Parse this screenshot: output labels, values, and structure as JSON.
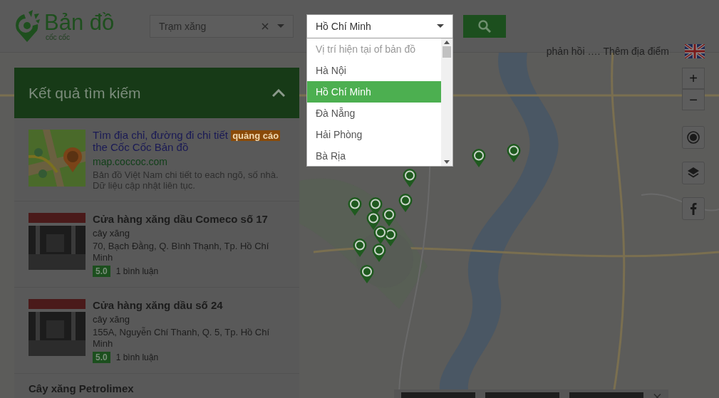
{
  "header": {
    "logo": {
      "title": "Bản đồ",
      "subtitle": "cốc cốc"
    },
    "search_field": {
      "value": "Trạm xăng"
    },
    "city_select": {
      "value": "Hồ Chí Minh",
      "expanded": true,
      "options": [
        {
          "label": "Vị trí hiện tại of bản đồ",
          "selected": false,
          "disabled": true
        },
        {
          "label": "Hà Nội",
          "selected": false,
          "disabled": false
        },
        {
          "label": "Hồ Chí Minh",
          "selected": true,
          "disabled": false
        },
        {
          "label": "Đà Nẵng",
          "selected": false,
          "disabled": false
        },
        {
          "label": "Hải Phòng",
          "selected": false,
          "disabled": false
        },
        {
          "label": "Bà Rịa",
          "selected": false,
          "disabled": false
        }
      ]
    }
  },
  "top_links": {
    "links": [
      "phản hồi",
      "Thêm địa điểm"
    ],
    "separator": "…."
  },
  "map_controls": {
    "zoom_in": "+",
    "zoom_out": "−"
  },
  "results_panel": {
    "title": "Kết quả tìm kiếm",
    "expanded": true,
    "items": [
      {
        "kind": "ad",
        "title": "Tìm địa chỉ, đường đi chi tiết",
        "badge": "quảng cáo",
        "title_rest": "the Cốc Cốc Bản đồ",
        "url": "map.coccoc.com",
        "description": "Bản đồ Việt Nam chi tiết to each ngõ, số nhà. Dữ liệu cập nhật liên tục."
      },
      {
        "kind": "place",
        "title": "Cửa hàng xăng dầu Comeco số 17",
        "category": "cây xăng",
        "address": "70, Bạch Đằng, Q. Bình Thạnh, Tp. Hồ Chí Minh",
        "rating": "5.0",
        "reviews": "1 bình luận"
      },
      {
        "kind": "place",
        "title": "Cửa hàng xăng dầu số 24",
        "category": "cây xăng",
        "address": "155A, Nguyễn Chí Thanh, Q. 5, Tp. Hồ Chí Minh",
        "rating": "5.0",
        "reviews": "1 bình luận"
      },
      {
        "kind": "place",
        "title": "Cây xăng Petrolimex"
      }
    ]
  }
}
